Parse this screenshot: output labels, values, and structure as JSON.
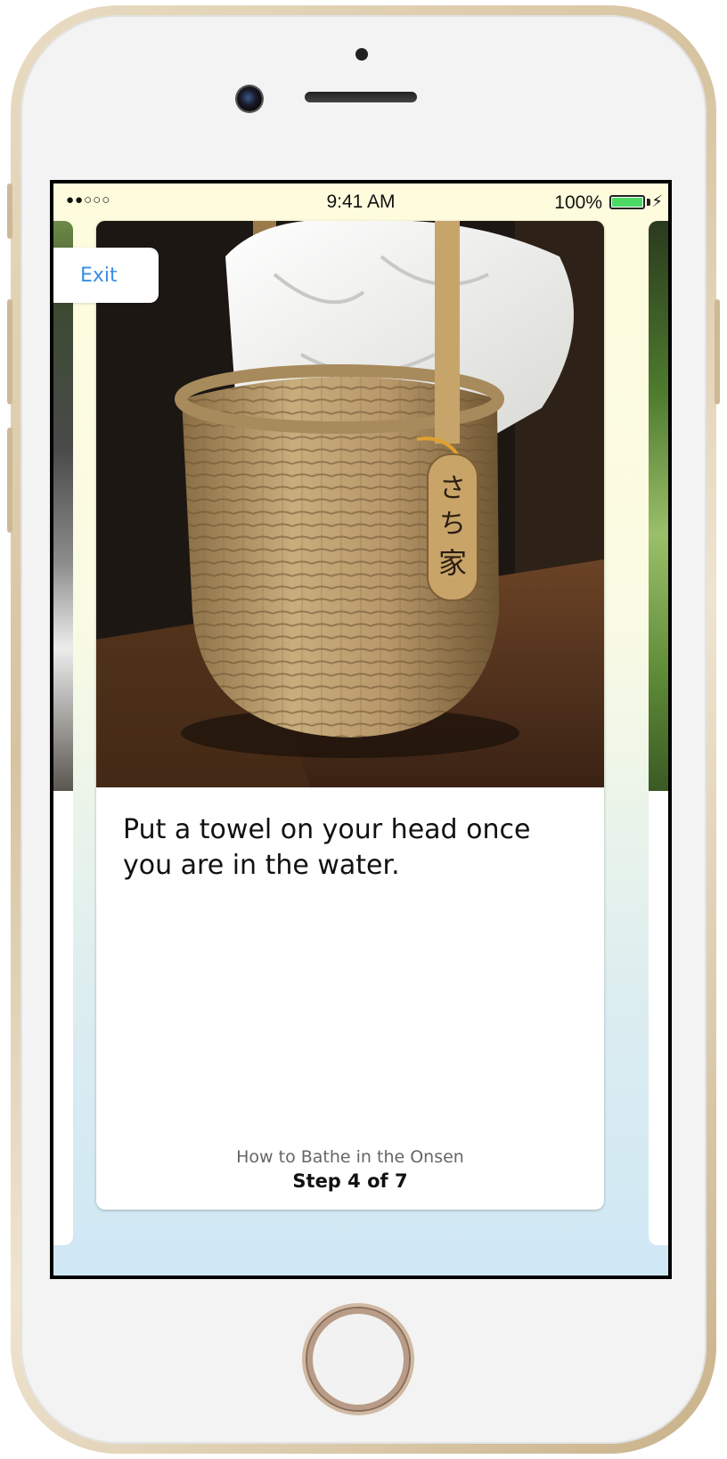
{
  "status_bar": {
    "signal": "●●○○○",
    "time": "9:41 AM",
    "battery_percent": "100%",
    "battery_level": 1.0,
    "battery_color": "#4cd964",
    "charging_icon": "bolt-icon"
  },
  "navigation": {
    "exit_label": "Exit"
  },
  "card": {
    "image_subject": "towel-in-basket-photo",
    "instruction": "Put a towel on your head once you are in the water.",
    "guide_title": "How to Bathe in the Onsen",
    "step_label": "Step 4 of 7"
  },
  "colors": {
    "accent": "#3a8fe3",
    "background_top": "#fffcdd",
    "background_bottom": "#cfe8f5"
  }
}
